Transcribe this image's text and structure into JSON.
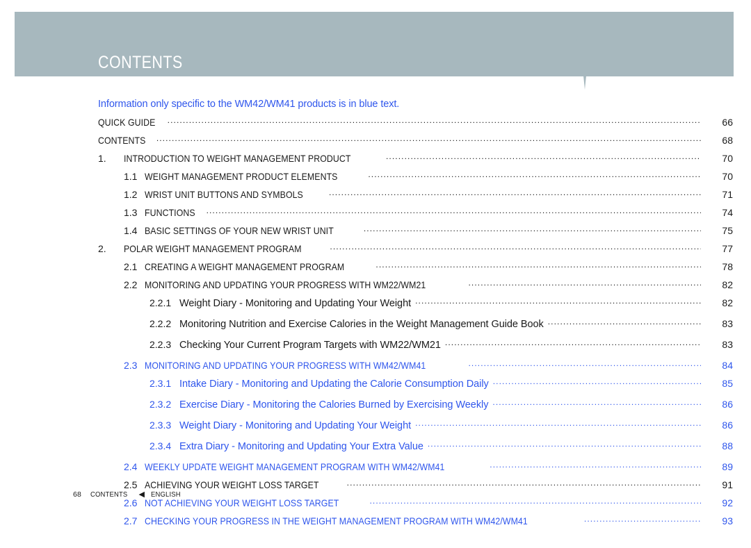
{
  "header": {
    "title": "CONTENTS",
    "band_color": "#a7b8be",
    "spike_icon": "ecg-heartbeat-spike"
  },
  "notice": {
    "text": "Information only specific to the WM42/WM41 products is in blue text.",
    "color": "#2f56ec"
  },
  "toc": {
    "entries": [
      {
        "level": 0,
        "number": "",
        "label": "QUICK GUIDE",
        "page": "66",
        "blue": false
      },
      {
        "level": 0,
        "number": "",
        "label": "CONTENTS",
        "page": "68",
        "blue": false
      },
      {
        "level": 1,
        "number": "1.",
        "label": "INTRODUCTION TO WEIGHT MANAGEMENT PRODUCT",
        "page": "70",
        "blue": false
      },
      {
        "level": 2,
        "number": "1.1",
        "label": "WEIGHT MANAGEMENT PRODUCT ELEMENTS",
        "page": "70",
        "blue": false
      },
      {
        "level": 2,
        "number": "1.2",
        "label": "WRIST UNIT BUTTONS AND SYMBOLS",
        "page": "71",
        "blue": false
      },
      {
        "level": 2,
        "number": "1.3",
        "label": "FUNCTIONS",
        "page": "74",
        "blue": false
      },
      {
        "level": 2,
        "number": "1.4",
        "label": "BASIC SETTINGS OF YOUR NEW WRIST UNIT",
        "page": "75",
        "blue": false
      },
      {
        "level": 1,
        "number": "2.",
        "label": "POLAR WEIGHT MANAGEMENT PROGRAM",
        "page": "77",
        "blue": false
      },
      {
        "level": 2,
        "number": "2.1",
        "label": "CREATING A WEIGHT MANAGEMENT PROGRAM",
        "page": "78",
        "blue": false
      },
      {
        "level": 2,
        "number": "2.2",
        "label": "MONITORING AND UPDATING YOUR PROGRESS WITH WM22/WM21",
        "page": "82",
        "blue": false
      },
      {
        "level": 3,
        "number": "2.2.1",
        "label": "Weight Diary - Monitoring and Updating Your Weight",
        "page": "82",
        "blue": false
      },
      {
        "level": 3,
        "number": "2.2.2",
        "label": "Monitoring Nutrition and Exercise Calories in the Weight Management Guide Book",
        "page": "83",
        "blue": false
      },
      {
        "level": 3,
        "number": "2.2.3",
        "label": "Checking Your Current Program Targets with WM22/WM21",
        "page": "83",
        "blue": false
      },
      {
        "level": 2,
        "number": "2.3",
        "label": "MONITORING AND UPDATING YOUR PROGRESS WITH WM42/WM41",
        "page": "84",
        "blue": true
      },
      {
        "level": 3,
        "number": "2.3.1",
        "label": "Intake Diary - Monitoring and Updating the Calorie Consumption Daily",
        "page": "85",
        "blue": true
      },
      {
        "level": 3,
        "number": "2.3.2",
        "label": "Exercise Diary - Monitoring the Calories Burned by Exercising Weekly",
        "page": "86",
        "blue": true
      },
      {
        "level": 3,
        "number": "2.3.3",
        "label": "Weight Diary - Monitoring and Updating Your Weight",
        "page": "86",
        "blue": true
      },
      {
        "level": 3,
        "number": "2.3.4",
        "label": "Extra Diary - Monitoring and Updating Your Extra Value",
        "page": "88",
        "blue": true
      },
      {
        "level": 2,
        "number": "2.4",
        "label": "WEEKLY UPDATE WEIGHT MANAGEMENT PROGRAM WITH WM42/WM41",
        "page": "89",
        "blue": true
      },
      {
        "level": 2,
        "number": "2.5",
        "label": "ACHIEVING YOUR WEIGHT LOSS TARGET",
        "page": "91",
        "blue": false
      },
      {
        "level": 2,
        "number": "2.6",
        "label": "NOT ACHIEVING YOUR WEIGHT LOSS TARGET",
        "page": "92",
        "blue": true
      },
      {
        "level": 2,
        "number": "2.7",
        "label": "CHECKING YOUR PROGRESS IN THE WEIGHT MANAGEMENT PROGRAM WITH WM42/WM41",
        "page": "93",
        "blue": true
      }
    ]
  },
  "footer": {
    "page_number": "68",
    "section": "CONTENTS",
    "arrow": "◀",
    "language": "ENGLISH"
  }
}
